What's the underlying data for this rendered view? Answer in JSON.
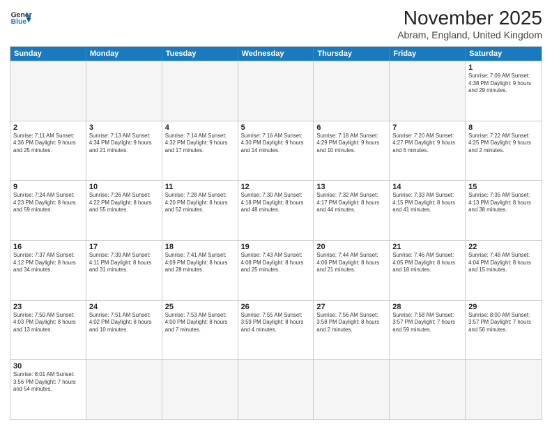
{
  "header": {
    "logo_line1": "General",
    "logo_line2": "Blue",
    "title": "November 2025",
    "subtitle": "Abram, England, United Kingdom"
  },
  "weekdays": [
    "Sunday",
    "Monday",
    "Tuesday",
    "Wednesday",
    "Thursday",
    "Friday",
    "Saturday"
  ],
  "rows": [
    [
      {
        "day": "",
        "info": ""
      },
      {
        "day": "",
        "info": ""
      },
      {
        "day": "",
        "info": ""
      },
      {
        "day": "",
        "info": ""
      },
      {
        "day": "",
        "info": ""
      },
      {
        "day": "",
        "info": ""
      },
      {
        "day": "1",
        "info": "Sunrise: 7:09 AM\nSunset: 4:38 PM\nDaylight: 9 hours\nand 29 minutes."
      }
    ],
    [
      {
        "day": "2",
        "info": "Sunrise: 7:11 AM\nSunset: 4:36 PM\nDaylight: 9 hours\nand 25 minutes."
      },
      {
        "day": "3",
        "info": "Sunrise: 7:13 AM\nSunset: 4:34 PM\nDaylight: 9 hours\nand 21 minutes."
      },
      {
        "day": "4",
        "info": "Sunrise: 7:14 AM\nSunset: 4:32 PM\nDaylight: 9 hours\nand 17 minutes."
      },
      {
        "day": "5",
        "info": "Sunrise: 7:16 AM\nSunset: 4:30 PM\nDaylight: 9 hours\nand 14 minutes."
      },
      {
        "day": "6",
        "info": "Sunrise: 7:18 AM\nSunset: 4:29 PM\nDaylight: 9 hours\nand 10 minutes."
      },
      {
        "day": "7",
        "info": "Sunrise: 7:20 AM\nSunset: 4:27 PM\nDaylight: 9 hours\nand 6 minutes."
      },
      {
        "day": "8",
        "info": "Sunrise: 7:22 AM\nSunset: 4:25 PM\nDaylight: 9 hours\nand 2 minutes."
      }
    ],
    [
      {
        "day": "9",
        "info": "Sunrise: 7:24 AM\nSunset: 4:23 PM\nDaylight: 8 hours\nand 59 minutes."
      },
      {
        "day": "10",
        "info": "Sunrise: 7:26 AM\nSunset: 4:22 PM\nDaylight: 8 hours\nand 55 minutes."
      },
      {
        "day": "11",
        "info": "Sunrise: 7:28 AM\nSunset: 4:20 PM\nDaylight: 8 hours\nand 52 minutes."
      },
      {
        "day": "12",
        "info": "Sunrise: 7:30 AM\nSunset: 4:18 PM\nDaylight: 8 hours\nand 48 minutes."
      },
      {
        "day": "13",
        "info": "Sunrise: 7:32 AM\nSunset: 4:17 PM\nDaylight: 8 hours\nand 44 minutes."
      },
      {
        "day": "14",
        "info": "Sunrise: 7:33 AM\nSunset: 4:15 PM\nDaylight: 8 hours\nand 41 minutes."
      },
      {
        "day": "15",
        "info": "Sunrise: 7:35 AM\nSunset: 4:13 PM\nDaylight: 8 hours\nand 38 minutes."
      }
    ],
    [
      {
        "day": "16",
        "info": "Sunrise: 7:37 AM\nSunset: 4:12 PM\nDaylight: 8 hours\nand 34 minutes."
      },
      {
        "day": "17",
        "info": "Sunrise: 7:39 AM\nSunset: 4:11 PM\nDaylight: 8 hours\nand 31 minutes."
      },
      {
        "day": "18",
        "info": "Sunrise: 7:41 AM\nSunset: 4:09 PM\nDaylight: 8 hours\nand 28 minutes."
      },
      {
        "day": "19",
        "info": "Sunrise: 7:43 AM\nSunset: 4:08 PM\nDaylight: 8 hours\nand 25 minutes."
      },
      {
        "day": "20",
        "info": "Sunrise: 7:44 AM\nSunset: 4:06 PM\nDaylight: 8 hours\nand 21 minutes."
      },
      {
        "day": "21",
        "info": "Sunrise: 7:46 AM\nSunset: 4:05 PM\nDaylight: 8 hours\nand 18 minutes."
      },
      {
        "day": "22",
        "info": "Sunrise: 7:48 AM\nSunset: 4:04 PM\nDaylight: 8 hours\nand 15 minutes."
      }
    ],
    [
      {
        "day": "23",
        "info": "Sunrise: 7:50 AM\nSunset: 4:03 PM\nDaylight: 8 hours\nand 13 minutes."
      },
      {
        "day": "24",
        "info": "Sunrise: 7:51 AM\nSunset: 4:02 PM\nDaylight: 8 hours\nand 10 minutes."
      },
      {
        "day": "25",
        "info": "Sunrise: 7:53 AM\nSunset: 4:00 PM\nDaylight: 8 hours\nand 7 minutes."
      },
      {
        "day": "26",
        "info": "Sunrise: 7:55 AM\nSunset: 3:59 PM\nDaylight: 8 hours\nand 4 minutes."
      },
      {
        "day": "27",
        "info": "Sunrise: 7:56 AM\nSunset: 3:58 PM\nDaylight: 8 hours\nand 2 minutes."
      },
      {
        "day": "28",
        "info": "Sunrise: 7:58 AM\nSunset: 3:57 PM\nDaylight: 7 hours\nand 59 minutes."
      },
      {
        "day": "29",
        "info": "Sunrise: 8:00 AM\nSunset: 3:57 PM\nDaylight: 7 hours\nand 56 minutes."
      }
    ],
    [
      {
        "day": "30",
        "info": "Sunrise: 8:01 AM\nSunset: 3:56 PM\nDaylight: 7 hours\nand 54 minutes."
      },
      {
        "day": "",
        "info": ""
      },
      {
        "day": "",
        "info": ""
      },
      {
        "day": "",
        "info": ""
      },
      {
        "day": "",
        "info": ""
      },
      {
        "day": "",
        "info": ""
      },
      {
        "day": "",
        "info": ""
      }
    ]
  ]
}
